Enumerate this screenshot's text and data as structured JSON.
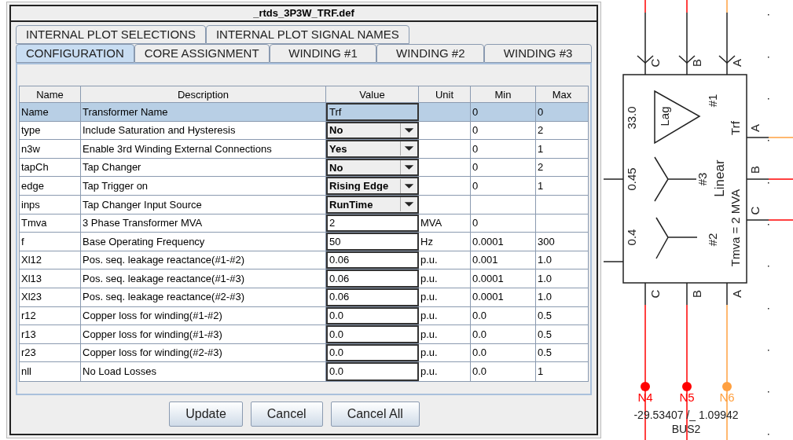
{
  "dialog": {
    "title": "_rtds_3P3W_TRF.def",
    "tab_rows": [
      [
        {
          "label": "INTERNAL PLOT SELECTIONS",
          "selected": false
        },
        {
          "label": "INTERNAL PLOT SIGNAL NAMES",
          "selected": false
        }
      ],
      [
        {
          "label": "CONFIGURATION",
          "selected": true
        },
        {
          "label": "CORE ASSIGNMENT",
          "selected": false
        },
        {
          "label": "WINDING #1",
          "selected": false
        },
        {
          "label": "WINDING #2",
          "selected": false
        },
        {
          "label": "WINDING #3",
          "selected": false
        }
      ]
    ],
    "table": {
      "columns": [
        "Name",
        "Description",
        "Value",
        "Unit",
        "Min",
        "Max"
      ],
      "rows": [
        {
          "name": "Name",
          "description": "Transformer Name",
          "value": "Trf",
          "kind": "text",
          "unit": "",
          "min": "0",
          "max": "0",
          "selected": true
        },
        {
          "name": "type",
          "description": "Include Saturation and Hysteresis",
          "value": "No",
          "kind": "dropdown",
          "unit": "",
          "min": "0",
          "max": "2",
          "selected": false
        },
        {
          "name": "n3w",
          "description": "Enable 3rd Winding External Connections",
          "value": "Yes",
          "kind": "dropdown",
          "unit": "",
          "min": "0",
          "max": "1",
          "selected": false
        },
        {
          "name": "tapCh",
          "description": "Tap Changer",
          "value": "No",
          "kind": "dropdown",
          "unit": "",
          "min": "0",
          "max": "2",
          "selected": false
        },
        {
          "name": "edge",
          "description": "Tap Trigger on",
          "value": "Rising Edge",
          "kind": "dropdown",
          "unit": "",
          "min": "0",
          "max": "1",
          "selected": false
        },
        {
          "name": "inps",
          "description": "Tap Changer Input Source",
          "value": "RunTime",
          "kind": "dropdown",
          "unit": "",
          "min": "",
          "max": "",
          "selected": false
        },
        {
          "name": "Tmva",
          "description": "3 Phase Transformer MVA",
          "value": "2",
          "kind": "text",
          "unit": "MVA",
          "min": "0",
          "max": "",
          "selected": false
        },
        {
          "name": "f",
          "description": "Base Operating Frequency",
          "value": "50",
          "kind": "text",
          "unit": "Hz",
          "min": "0.0001",
          "max": "300",
          "selected": false
        },
        {
          "name": "Xl12",
          "description": "Pos. seq. leakage reactance(#1-#2)",
          "value": "0.06",
          "kind": "text",
          "unit": "p.u.",
          "min": "0.001",
          "max": "1.0",
          "selected": false
        },
        {
          "name": "Xl13",
          "description": "Pos. seq. leakage reactance(#1-#3)",
          "value": "0.06",
          "kind": "text",
          "unit": "p.u.",
          "min": "0.0001",
          "max": "1.0",
          "selected": false
        },
        {
          "name": "Xl23",
          "description": "Pos. seq. leakage reactance(#2-#3)",
          "value": "0.06",
          "kind": "text",
          "unit": "p.u.",
          "min": "0.0001",
          "max": "1.0",
          "selected": false
        },
        {
          "name": "r12",
          "description": "Copper loss for winding(#1-#2)",
          "value": "0.0",
          "kind": "text",
          "unit": "p.u.",
          "min": "0.0",
          "max": "0.5",
          "selected": false
        },
        {
          "name": "r13",
          "description": "Copper loss for winding(#1-#3)",
          "value": "0.0",
          "kind": "text",
          "unit": "p.u.",
          "min": "0.0",
          "max": "0.5",
          "selected": false
        },
        {
          "name": "r23",
          "description": "Copper loss for winding(#2-#3)",
          "value": "0.0",
          "kind": "text",
          "unit": "p.u.",
          "min": "0.0",
          "max": "0.5",
          "selected": false
        },
        {
          "name": "nll",
          "description": "No Load Losses",
          "value": "0.0",
          "kind": "text",
          "unit": "p.u.",
          "min": "0.0",
          "max": "1",
          "selected": false
        }
      ]
    },
    "buttons": [
      "Update",
      "Cancel",
      "Cancel All"
    ]
  },
  "schematic": {
    "top_ports": [
      "C",
      "B",
      "A"
    ],
    "bottom_ports": [
      "C",
      "B",
      "A"
    ],
    "right_ports": [
      "A",
      "B",
      "C"
    ],
    "labels": {
      "winding1_voltage": "33.0",
      "lag": "Lag",
      "winding1": "#1",
      "name": "Trf",
      "winding3_voltage": "0.45",
      "winding3": "#3",
      "model": "Linear",
      "rating": "Tmva = 2 MVA",
      "winding2_voltage": "0.4",
      "winding2": "#2"
    },
    "nodes": [
      {
        "label": "N4",
        "color": "#ff0000"
      },
      {
        "label": "N5",
        "color": "#ff0000"
      },
      {
        "label": "N6",
        "color": "#ffa040"
      }
    ],
    "reading": "-29.53407 /_  1.09942",
    "bus": "BUS2"
  }
}
